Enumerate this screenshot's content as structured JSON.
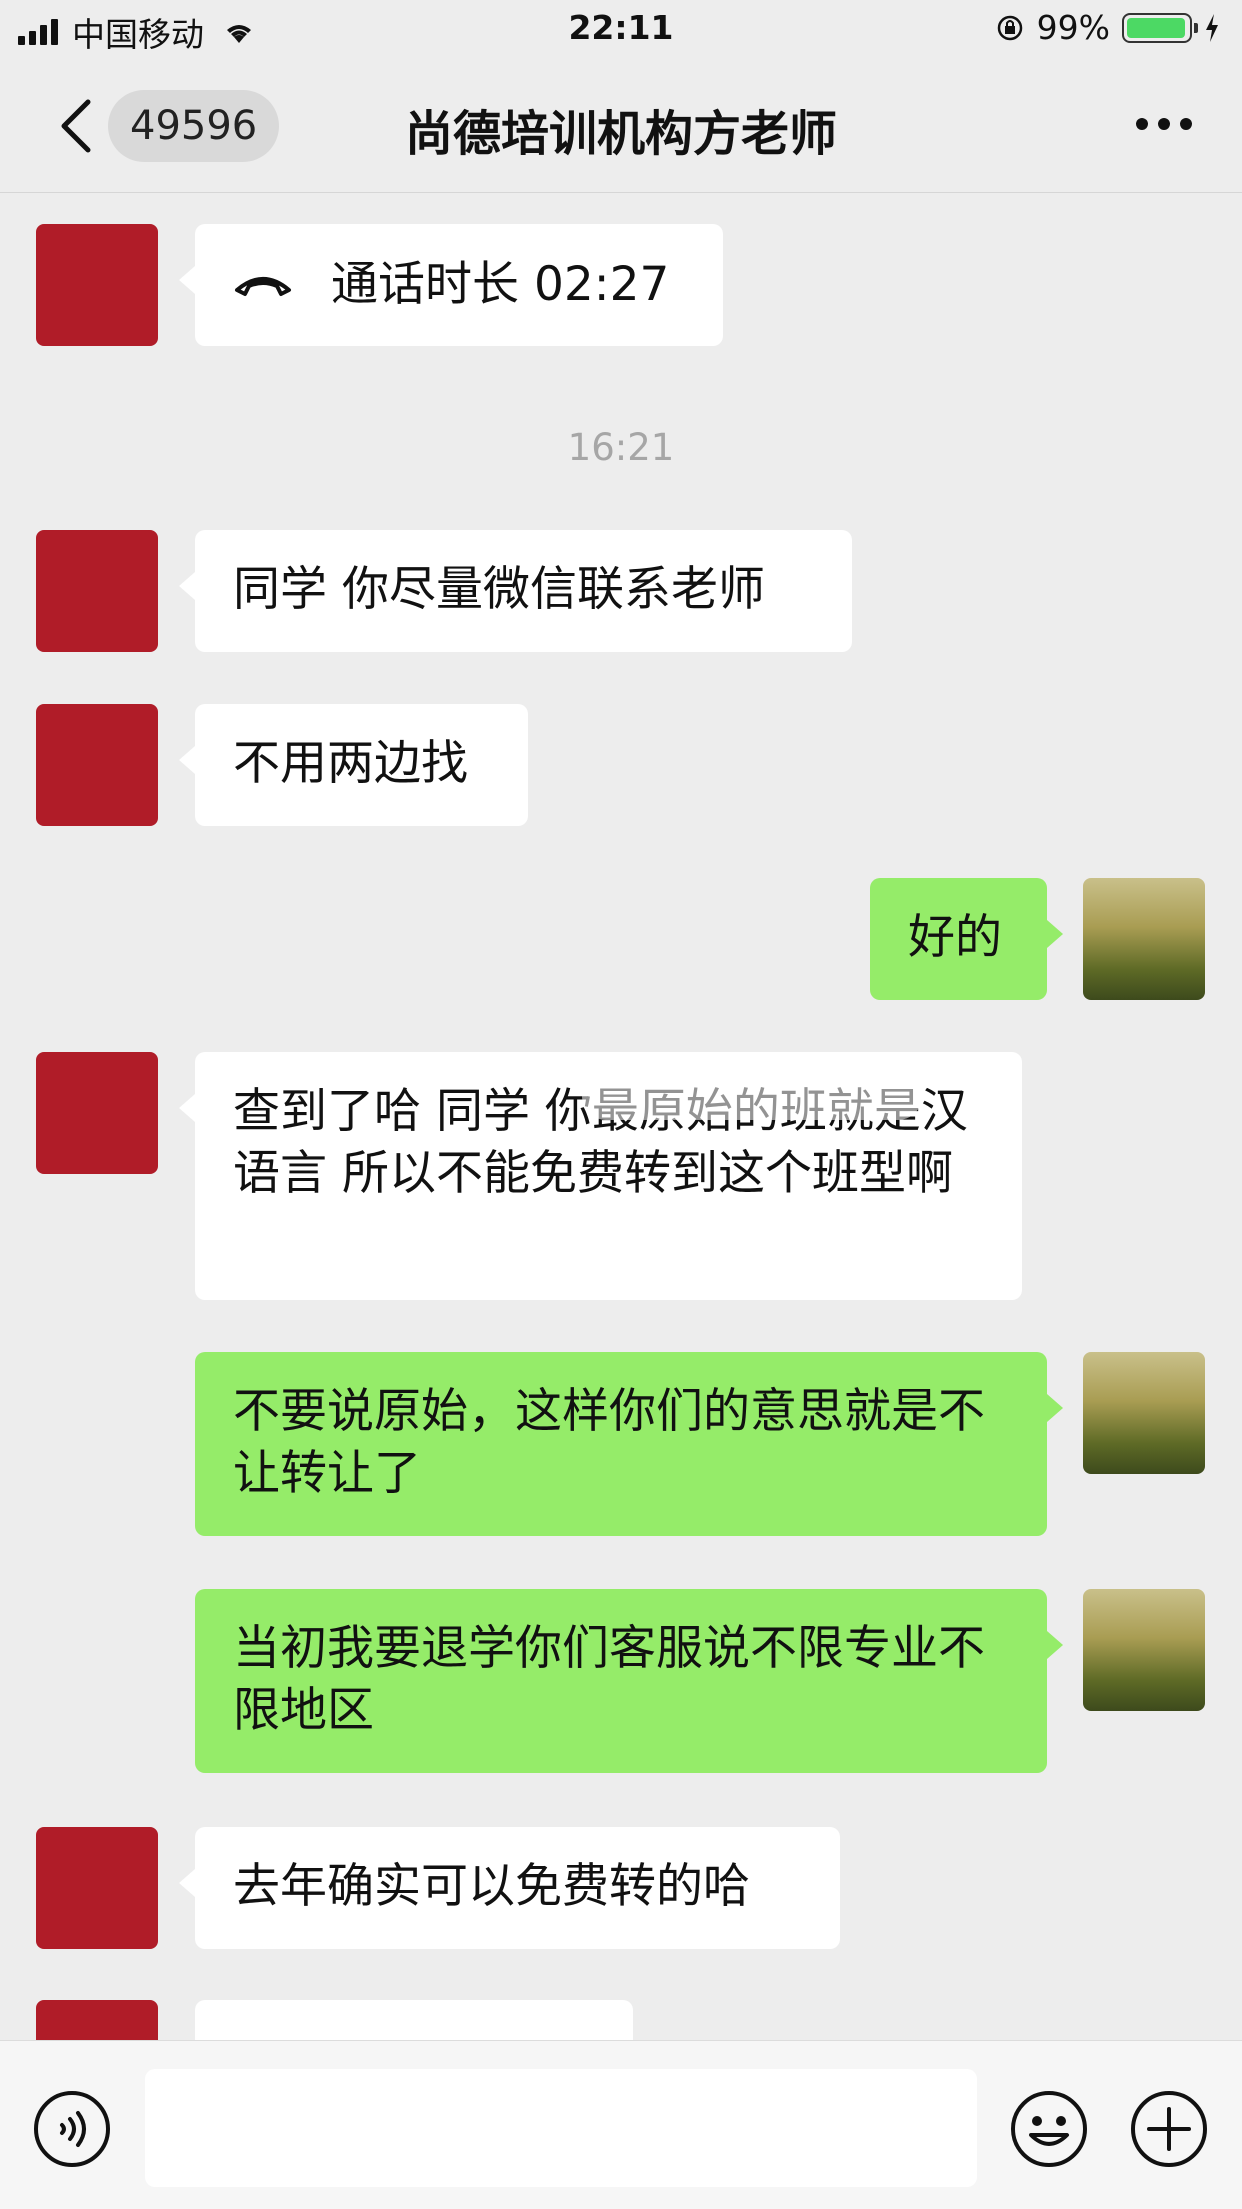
{
  "status_bar": {
    "carrier": "中国移动",
    "time": "22:11",
    "battery": "99%",
    "battery_level": 0.99
  },
  "nav": {
    "back_icon": "chevron-left-icon",
    "unread_count": "49596",
    "title": "尚德培训机构方老师",
    "more_icon": "ellipsis-icon"
  },
  "messages": [
    {
      "side": "in",
      "type": "call",
      "icon": "phone-hangup-icon",
      "text": "通话时长 02:27"
    },
    {
      "type": "timestamp",
      "text": "16:21"
    },
    {
      "side": "in",
      "text": "同学 你尽量微信联系老师"
    },
    {
      "side": "in",
      "text": "不用两边找"
    },
    {
      "side": "out",
      "text": "好的"
    },
    {
      "side": "in",
      "text": "查到了哈 同学 你最原始的班就是汉语言 所以不能免费转到这个班型啊"
    },
    {
      "side": "out",
      "text": "不要说原始，这样你们的意思就是不让转让了"
    },
    {
      "side": "out",
      "text": "当初我要退学你们客服说不限专业不限地区"
    },
    {
      "side": "in",
      "text": "去年确实可以免费转的哈"
    }
  ],
  "input_bar": {
    "voice_icon": "voice-icon",
    "emoji_icon": "emoji-icon",
    "plus_icon": "plus-icon"
  },
  "colors": {
    "background": "#ededed",
    "outgoing_bubble": "#95ec69",
    "incoming_bubble": "#ffffff",
    "battery": "#4cd964"
  }
}
